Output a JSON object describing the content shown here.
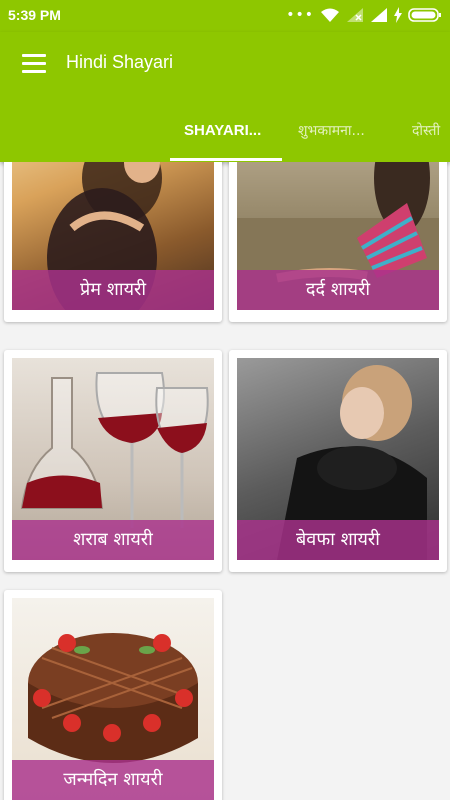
{
  "status": {
    "time": "5:39 PM",
    "dots": "•••"
  },
  "appbar": {
    "title": "Hindi Shayari"
  },
  "tabs": [
    {
      "label": "SHAYARI..."
    },
    {
      "label": "शुभकामना..."
    },
    {
      "label": "दोस्ती"
    }
  ],
  "cards": [
    {
      "title": "प्रेम शायरी"
    },
    {
      "title": "दर्द शायरी"
    },
    {
      "title": "शराब शायरी"
    },
    {
      "title": "बेवफा शायरी"
    },
    {
      "title": "जन्मदिन शायरी"
    }
  ],
  "colors": {
    "primary": "#8ec700",
    "caption_overlay": "#aa328c"
  }
}
